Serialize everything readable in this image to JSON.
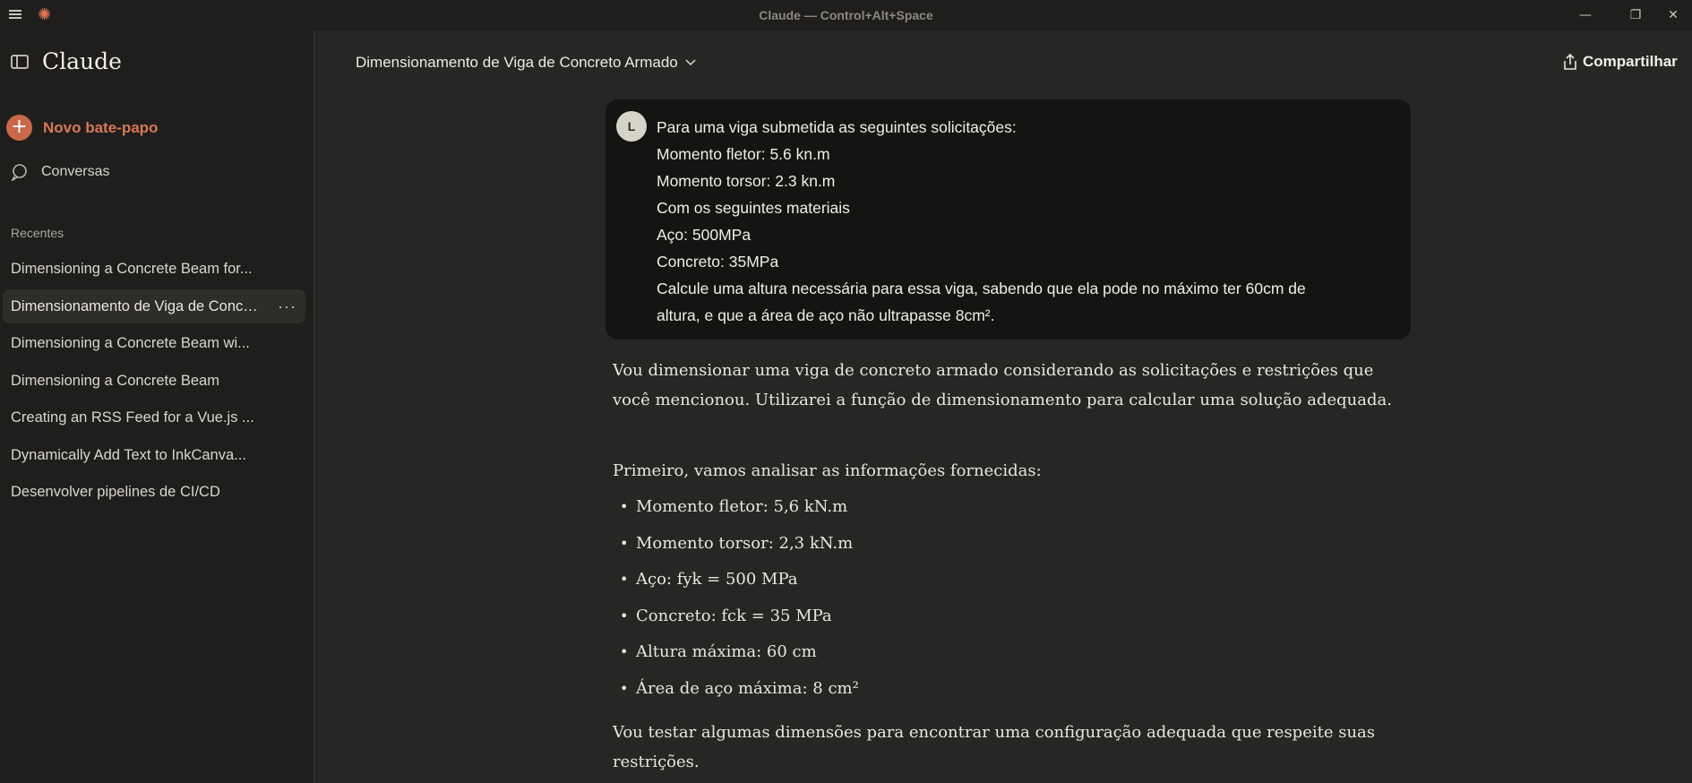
{
  "titlebar": {
    "title": "Claude — Control+Alt+Space",
    "min": "—",
    "max": "❐",
    "close": "✕"
  },
  "sidebar": {
    "brand": "Claude",
    "new_chat": "Novo bate-papo",
    "conversations": "Conversas",
    "recents_label": "Recentes",
    "recents": [
      {
        "label": "Dimensioning a Concrete Beam for..."
      },
      {
        "label": "Dimensionamento de Viga de Concreto Armado",
        "active": true
      },
      {
        "label": "Dimensioning a Concrete Beam wi..."
      },
      {
        "label": "Dimensioning a Concrete Beam"
      },
      {
        "label": "Creating an RSS Feed for a Vue.js ..."
      },
      {
        "label": "Dynamically Add Text to InkCanva..."
      },
      {
        "label": "Desenvolver pipelines de CI/CD"
      }
    ],
    "more_dots": "···"
  },
  "header": {
    "title": "Dimensionamento de Viga de Concreto Armado",
    "share": "Compartilhar"
  },
  "user_message": {
    "avatar": "L",
    "lines": [
      "Para uma viga submetida as seguintes solicitações:",
      "Momento fletor: 5.6 kn.m",
      "Momento torsor: 2.3 kn.m",
      "Com os seguintes materiais",
      "Aço: 500MPa",
      "Concreto: 35MPa",
      "Calcule uma altura necessária para essa viga, sabendo que ela pode no máximo ter 60cm de",
      "altura, e que a área de aço não ultrapasse 8cm²."
    ]
  },
  "assistant": {
    "p1": "Vou dimensionar uma viga de concreto armado considerando as solicitações e restrições que você mencionou. Utilizarei a função de dimensionamento para calcular uma solução adequada.",
    "p2": "Primeiro, vamos analisar as informações fornecidas:",
    "bullets": [
      "Momento fletor: 5,6 kN.m",
      "Momento torsor: 2,3 kN.m",
      "Aço: fyk = 500 MPa",
      "Concreto: fck = 35 MPa",
      "Altura máxima: 60 cm",
      "Área de aço máxima: 8 cm²"
    ],
    "p3": "Vou testar algumas dimensões para encontrar uma configuração adequada que respeite suas restrições."
  }
}
